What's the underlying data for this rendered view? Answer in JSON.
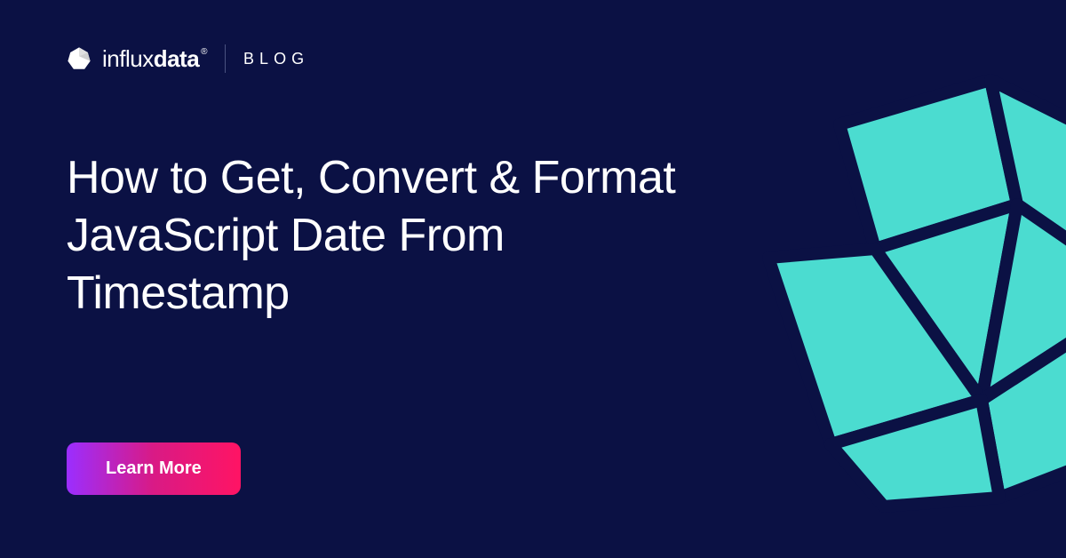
{
  "header": {
    "brand_prefix": "influx",
    "brand_suffix": "data",
    "blog_label": "BLOG"
  },
  "headline": "How to Get, Convert & Format JavaScript Date From Timestamp",
  "cta": {
    "label": "Learn More"
  },
  "colors": {
    "background": "#0b1144",
    "accent_cyan": "#4bdcd0",
    "gradient_start": "#9b2eff",
    "gradient_end": "#ff1464"
  }
}
